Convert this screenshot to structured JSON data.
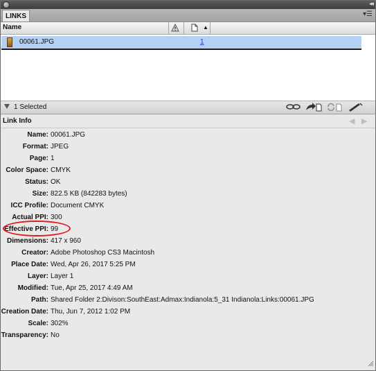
{
  "panel": {
    "tab_label": "LINKS",
    "collapse_icon": "double-arrow-icon",
    "menu_icon": "panel-menu-icon"
  },
  "columns": {
    "name_header": "Name",
    "status_icon": "warning-icon",
    "page_icon": "page-icon",
    "sort_icon": "sort-ascending-icon"
  },
  "links": [
    {
      "name": "00061.JPG",
      "page": "1",
      "selected": true
    }
  ],
  "status": {
    "selected_text": "1 Selected",
    "tools": [
      "relink-icon",
      "go-to-link-icon",
      "update-link-icon",
      "edit-original-icon"
    ]
  },
  "info": {
    "title": "Link Info",
    "fields": [
      {
        "label": "Name:",
        "value": "00061.JPG"
      },
      {
        "label": "Format:",
        "value": "JPEG"
      },
      {
        "label": "Page:",
        "value": "1"
      },
      {
        "label": "Color Space:",
        "value": "CMYK"
      },
      {
        "label": "Status:",
        "value": "OK"
      },
      {
        "label": "Size:",
        "value": "822.5 KB (842283 bytes)"
      },
      {
        "label": "ICC Profile:",
        "value": "Document CMYK"
      },
      {
        "label": "Actual PPI:",
        "value": "300"
      },
      {
        "label": "Effective PPI:",
        "value": "99"
      },
      {
        "label": "Dimensions:",
        "value": "417 x 960"
      },
      {
        "label": "Creator:",
        "value": "Adobe Photoshop CS3 Macintosh"
      },
      {
        "label": "Place Date:",
        "value": "Wed, Apr 26, 2017 5:25 PM"
      },
      {
        "label": "Layer:",
        "value": "Layer 1"
      },
      {
        "label": "Modified:",
        "value": "Tue, Apr 25, 2017 4:49 AM"
      },
      {
        "label": "Path:",
        "value": "Shared Folder 2:Divison:SouthEast:Admax:Indianola:5_31 Indianola:Links:00061.JPG"
      },
      {
        "label": "Creation Date:",
        "value": "Thu, Jun 7, 2012 1:02 PM"
      },
      {
        "label": "Scale:",
        "value": "302%"
      },
      {
        "label": "Transparency:",
        "value": "No"
      }
    ]
  },
  "annotation": {
    "highlight_color": "#e0191c",
    "highlighted_field": "Effective PPI:"
  },
  "colors": {
    "selection": "#b4d0f3",
    "link": "#2a3fd1"
  }
}
